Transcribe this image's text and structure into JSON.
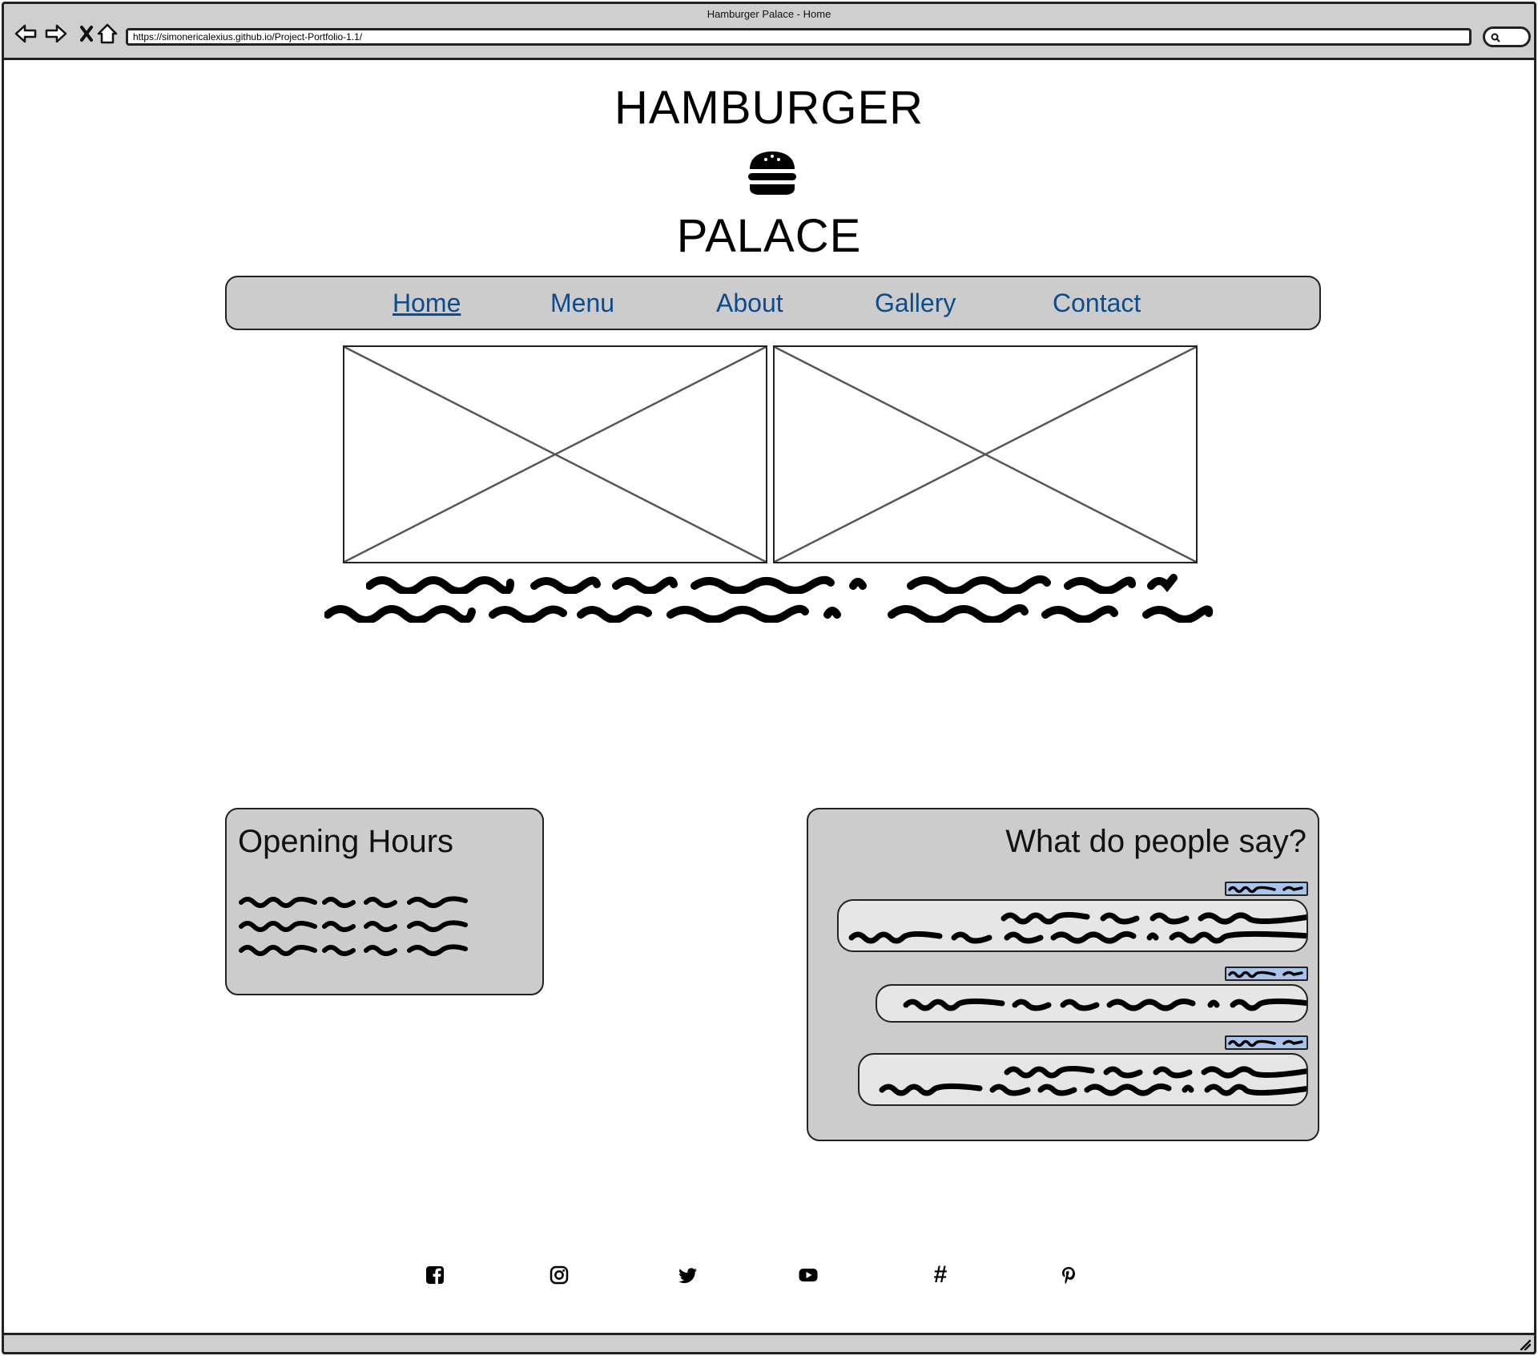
{
  "browser": {
    "window_title": "Hamburger Palace - Home",
    "url": "https://simonericalexius.github.io/Project-Portfolio-1.1/"
  },
  "header": {
    "logo_top": "HAMBURGER",
    "logo_bottom": "PALACE",
    "logo_icon": "hamburger-icon"
  },
  "nav": {
    "items": [
      {
        "label": "Home",
        "active": true
      },
      {
        "label": "Menu",
        "active": false
      },
      {
        "label": "About",
        "active": false
      },
      {
        "label": "Gallery",
        "active": false
      },
      {
        "label": "Contact",
        "active": false
      }
    ]
  },
  "opening_hours": {
    "title": "Opening Hours"
  },
  "reviews": {
    "title": "What do people say?"
  },
  "footer": {
    "social_icons": [
      "facebook-icon",
      "instagram-icon",
      "twitter-icon",
      "youtube-icon",
      "hashtag-icon",
      "pinterest-icon"
    ],
    "hashtag_glyph": "#"
  },
  "colors": {
    "nav_link": "#0d4c8c",
    "panel_bg": "#cccccc",
    "bubble_bg": "#e6e6e6",
    "name_tag": "#a9c4eb",
    "chrome": "#cfcfcf"
  }
}
